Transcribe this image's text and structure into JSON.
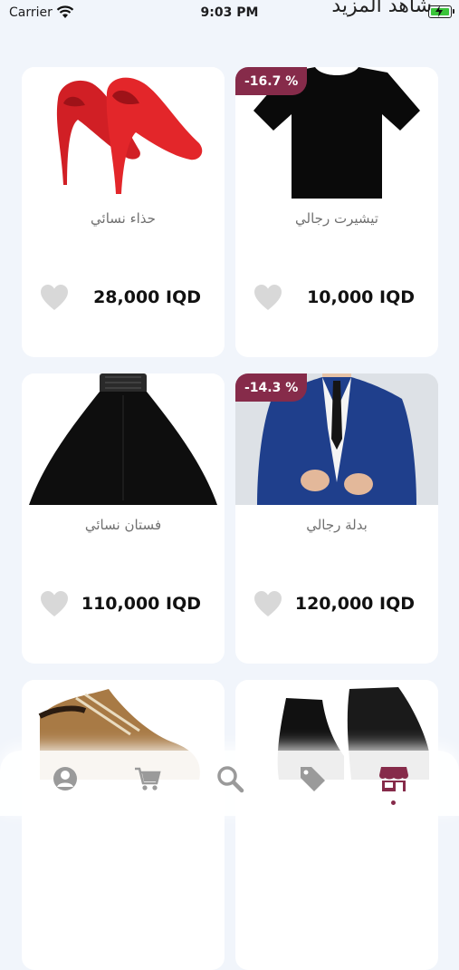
{
  "status_bar": {
    "carrier": "Carrier",
    "time": "9:03 PM"
  },
  "header": {
    "title": "شاهد المزيد"
  },
  "products": [
    {
      "name": "حذاء نسائي",
      "price": "28,000 IQD",
      "discount": ""
    },
    {
      "name": "تيشيرت رجالي",
      "price": "10,000 IQD",
      "discount": "-16.7 %"
    },
    {
      "name": "فستان نسائي",
      "price": "110,000 IQD",
      "discount": ""
    },
    {
      "name": "بدلة رجالي",
      "price": "120,000 IQD",
      "discount": "-14.3 %"
    }
  ],
  "icons": {
    "favorite": "heart-icon",
    "tabs": [
      "profile-icon",
      "cart-icon",
      "search-icon",
      "offers-tag-icon",
      "store-icon"
    ]
  },
  "colors": {
    "accent": "#862b4a",
    "background": "#f1f5fb",
    "heart": "#d8d8d8",
    "inactive_icon": "#9a9a9a"
  }
}
